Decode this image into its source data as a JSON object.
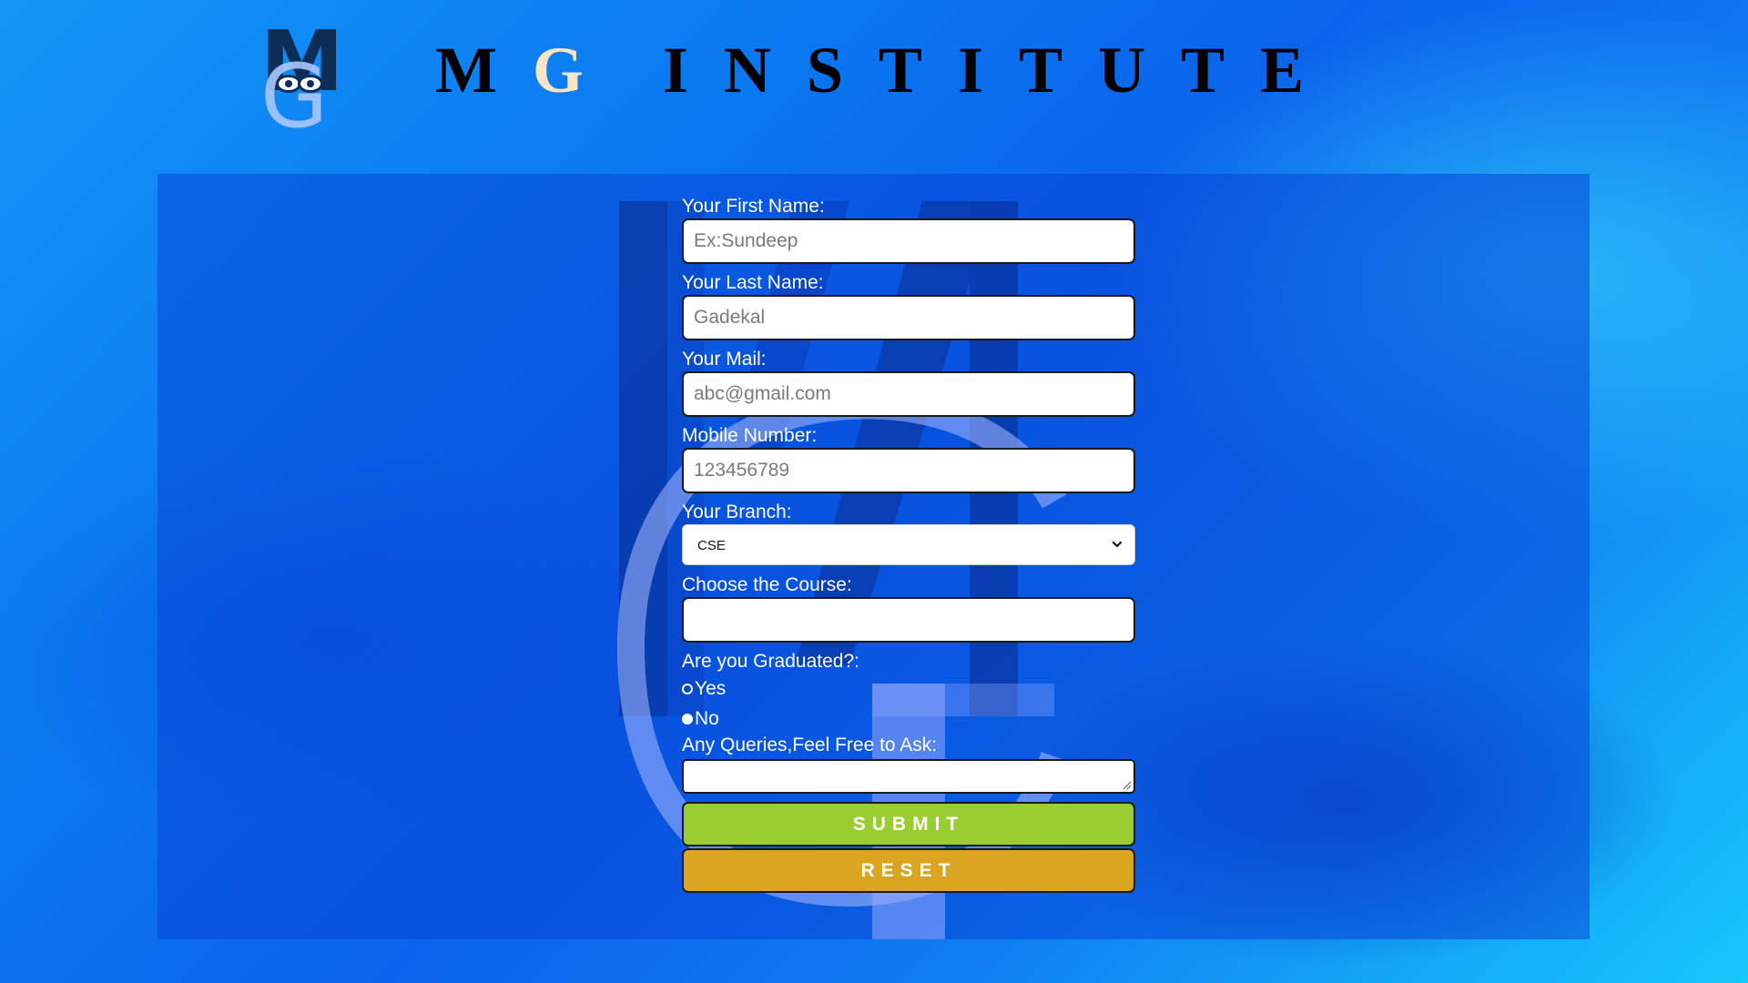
{
  "header": {
    "logo_letter_top": "M",
    "logo_letter_bottom": "G",
    "title_initial_m": "M",
    "title_initial_g": "G",
    "title_rest": "INSTITUTE",
    "title_accent_color": "#fce4c4"
  },
  "watermark": {
    "letter_top": "M",
    "letter_bottom": "G"
  },
  "form": {
    "first_name": {
      "label": "Your First Name:",
      "placeholder": "Ex:Sundeep",
      "value": ""
    },
    "last_name": {
      "label": "Your Last Name:",
      "placeholder": "Gadekal",
      "value": ""
    },
    "mail": {
      "label": "Your Mail:",
      "placeholder": "abc@gmail.com",
      "value": ""
    },
    "mobile": {
      "label": "Mobile Number:",
      "placeholder": "123456789",
      "value": ""
    },
    "branch": {
      "label": "Your Branch:",
      "selected": "CSE",
      "icon": "chevron-down-icon"
    },
    "course": {
      "label": "Choose the Course:",
      "value": ""
    },
    "graduated": {
      "label": "Are you Graduated?:",
      "options": [
        {
          "label": "Yes",
          "checked": false
        },
        {
          "label": "No",
          "checked": true
        }
      ]
    },
    "queries": {
      "label": "Any Queries,Feel Free to Ask:",
      "value": ""
    },
    "submit_label": "SUBMIT",
    "reset_label": "RESET"
  },
  "colors": {
    "submit": "#9acd32",
    "reset": "#daa520",
    "panel": "#0846d7",
    "label_text": "#ffffff"
  }
}
